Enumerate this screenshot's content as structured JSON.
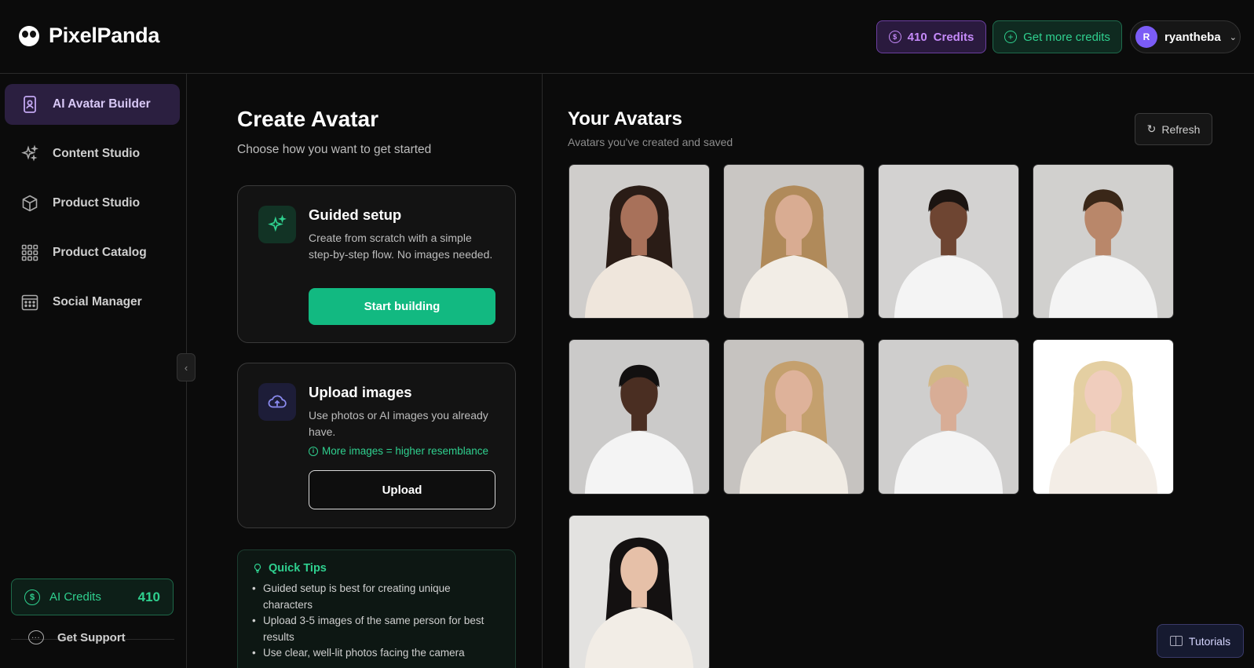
{
  "brand": {
    "name": "PixelPanda"
  },
  "header": {
    "credits_value": "410",
    "credits_label": "Credits",
    "get_more_label": "Get more credits",
    "user_initial": "R",
    "username": "ryantheba"
  },
  "sidebar": {
    "items": [
      {
        "label": "AI Avatar Builder",
        "active": true
      },
      {
        "label": "Content Studio"
      },
      {
        "label": "Product Studio"
      },
      {
        "label": "Product Catalog"
      },
      {
        "label": "Social Manager"
      }
    ],
    "ai_credits_label": "AI Credits",
    "ai_credits_value": "410",
    "support_label": "Get Support"
  },
  "create": {
    "title": "Create Avatar",
    "subtitle": "Choose how you want to get started",
    "guided": {
      "title": "Guided setup",
      "description": "Create from scratch with a simple step-by-step flow. No images needed.",
      "button": "Start building"
    },
    "upload": {
      "title": "Upload images",
      "description": "Use photos or AI images you already have.",
      "hint": "More images = higher resemblance",
      "button": "Upload"
    },
    "tips": {
      "title": "Quick Tips",
      "items": [
        "Guided setup is best for creating unique characters",
        "Upload 3-5 images of the same person for best results",
        "Use clear, well-lit photos facing the camera"
      ]
    }
  },
  "avatars": {
    "title": "Your Avatars",
    "subtitle": "Avatars you've created and saved",
    "refresh_label": "Refresh",
    "count": 9
  },
  "tutorials_label": "Tutorials",
  "colors": {
    "accent_green": "#12b981",
    "accent_purple": "#c58af9",
    "background": "#0b0b0b"
  }
}
